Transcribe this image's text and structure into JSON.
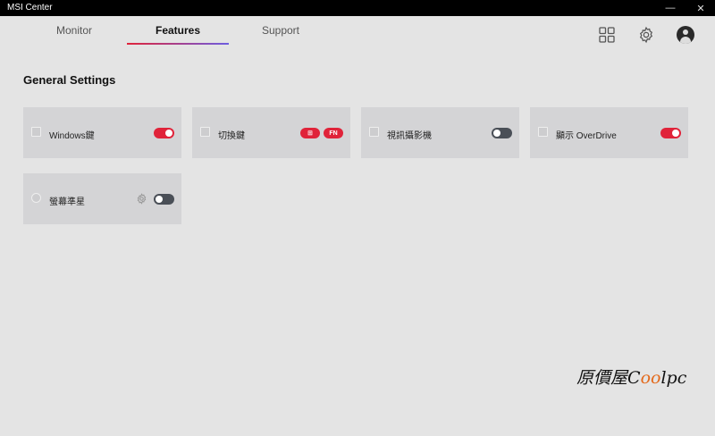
{
  "window": {
    "title": "MSI Center",
    "minimize_glyph": "—",
    "close_glyph": "✕"
  },
  "tabs": [
    {
      "label": "Monitor",
      "active": false
    },
    {
      "label": "Features",
      "active": true
    },
    {
      "label": "Support",
      "active": false
    }
  ],
  "header_icons": [
    "grid-icon",
    "gear-icon",
    "avatar"
  ],
  "section": {
    "title": "General Settings"
  },
  "cards": [
    {
      "label": "Windows鍵",
      "control": "toggle",
      "state": "on"
    },
    {
      "label": "切換鍵",
      "control": "pills",
      "pills": [
        "⊞",
        "FN"
      ]
    },
    {
      "label": "視訊攝影機",
      "control": "toggle",
      "state": "off"
    },
    {
      "label": "顯示 OverDrive",
      "control": "toggle",
      "state": "on"
    },
    {
      "label": "螢幕準星",
      "control": "toggle",
      "state": "off",
      "has_settings": true
    }
  ],
  "colors": {
    "accent": "#e0233a",
    "toggle_off": "#4a4f57",
    "card_bg": "#d4d4d6",
    "page_bg": "#e4e4e4"
  },
  "watermark": {
    "text_a": "原價屋",
    "text_b": "C",
    "text_c": "oo",
    "text_d": "lpc"
  }
}
